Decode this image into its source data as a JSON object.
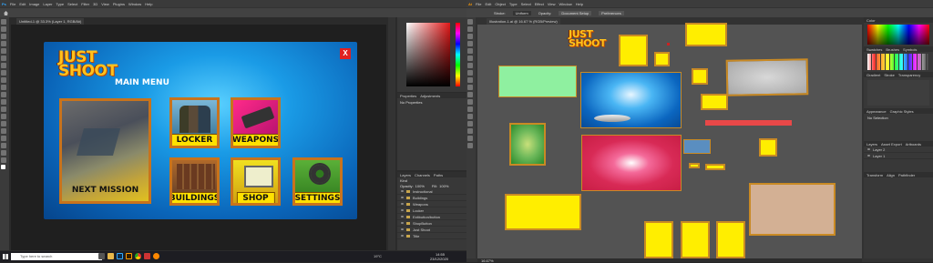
{
  "photoshop": {
    "menu": [
      "File",
      "Edit",
      "Image",
      "Layer",
      "Type",
      "Select",
      "Filter",
      "3D",
      "View",
      "Plugins",
      "Window",
      "Help"
    ],
    "doc_tab": "Untitled-1 @ 33.3% (Layer 1, RGB/8#)",
    "properties": {
      "title": "Properties",
      "tab2": "Adjustments",
      "sub": "No Properties"
    },
    "layers": {
      "tabs": [
        "Layers",
        "Channels",
        "Paths"
      ],
      "kind": "Kind",
      "opacity_label": "Opacity:",
      "opacity": "100%",
      "fill_label": "Fill:",
      "fill": "100%",
      "rows": [
        "Instructional",
        "Buildings",
        "Weapons",
        "Locker",
        "Exitbutton/button",
        "ShopButton",
        "Just Shoot",
        "Title"
      ]
    }
  },
  "game": {
    "logo_line1": "JUST",
    "logo_line2": "SHOOT",
    "title": "MAIN MENU",
    "close": "X",
    "buttons": {
      "next_mission": "NEXT MISSION",
      "locker": "LOCKER",
      "weapons": "WEAPONS",
      "buildings": "BUILDINGS",
      "shop": "SHOP",
      "settings": "SETTINGS"
    }
  },
  "illustrator": {
    "menu": [
      "File",
      "Edit",
      "Object",
      "Type",
      "Select",
      "Effect",
      "View",
      "Window",
      "Help"
    ],
    "doc_tab": "Illustration-1.ai @ 16.67 % (RGB/Preview)",
    "options": [
      "Stroke:",
      "Uniform",
      "Opacity:",
      "Document Setup",
      "Preferences"
    ],
    "panels": {
      "color": "Color",
      "swatches_tabs": [
        "Swatches",
        "Brushes",
        "Symbols"
      ],
      "gradient_tabs": [
        "Gradient",
        "Stroke",
        "Transparency"
      ],
      "appearance_tabs": [
        "Appearance",
        "Graphic Styles"
      ],
      "appearance_item": "No Selection",
      "layers_tabs": [
        "Layers",
        "Asset Export",
        "Artboards"
      ],
      "layer_rows": [
        "Layer 2",
        "Layer 1"
      ],
      "properties_tabs": [
        "Transform",
        "Align",
        "Pathfinder"
      ]
    },
    "logo_line1": "JUST",
    "logo_line2": "SHOOT",
    "status_zoom": "16.67%"
  },
  "taskbar": {
    "search": "Type here to search",
    "temp": "19°C",
    "time": "14:55",
    "date": "23/12/2020"
  },
  "colors": {
    "accent_yellow": "#ffee00",
    "button_border": "#c8731c",
    "close_red": "#e02020",
    "game_blue": "#1a9be6"
  }
}
